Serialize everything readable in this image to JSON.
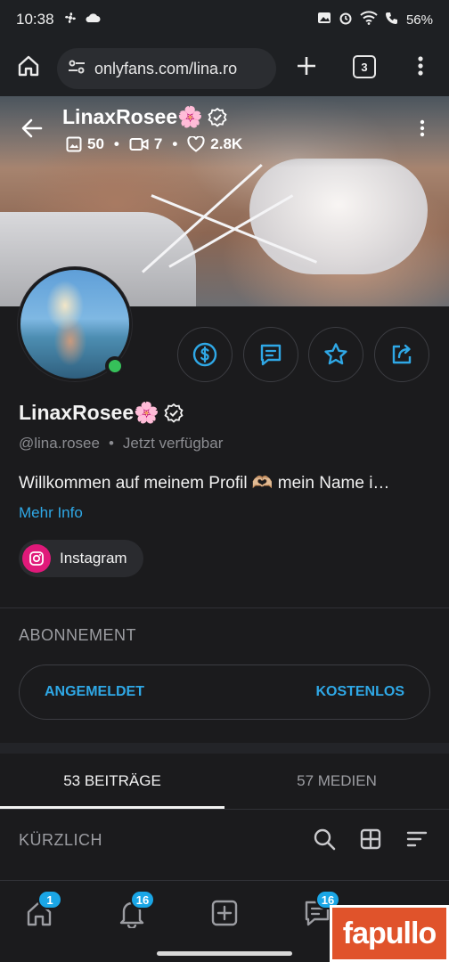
{
  "status_bar": {
    "time": "10:38",
    "battery_text": "56%",
    "icons": [
      "fan-icon",
      "cloud-icon",
      "photo-notif-icon",
      "alarm-icon",
      "wifi-icon",
      "call-icon",
      "battery-icon"
    ]
  },
  "browser": {
    "url": "onlyfans.com/lina.ro",
    "tab_count": "3"
  },
  "header": {
    "name": "LinaxRosee🌸",
    "photos": "50",
    "videos": "7",
    "likes": "2.8K"
  },
  "profile": {
    "name": "LinaxRosee🌸",
    "handle": "@lina.rosee",
    "separator": "•",
    "availability": "Jetzt verfügbar",
    "bio": "Willkommen auf meinem Profil 🫶🏼 mein Name i…",
    "more_info": "Mehr Info",
    "instagram_label": "Instagram"
  },
  "subscription": {
    "title": "ABONNEMENT",
    "status": "ANGEMELDET",
    "price": "KOSTENLOS"
  },
  "tabs": [
    {
      "label": "53 BEITRÄGE",
      "active": true
    },
    {
      "label": "57 MEDIEN",
      "active": false
    }
  ],
  "recent": {
    "label": "KÜRZLICH"
  },
  "bottom_nav": {
    "home_badge": "1",
    "notifications_badge": "16",
    "messages_badge": "16"
  },
  "watermark": "fapullo",
  "colors": {
    "accent": "#2fa8e6",
    "background": "#1b1b1d",
    "online": "#36c05a",
    "instagram": "#e0197a",
    "badge": "#1aa6e6"
  }
}
